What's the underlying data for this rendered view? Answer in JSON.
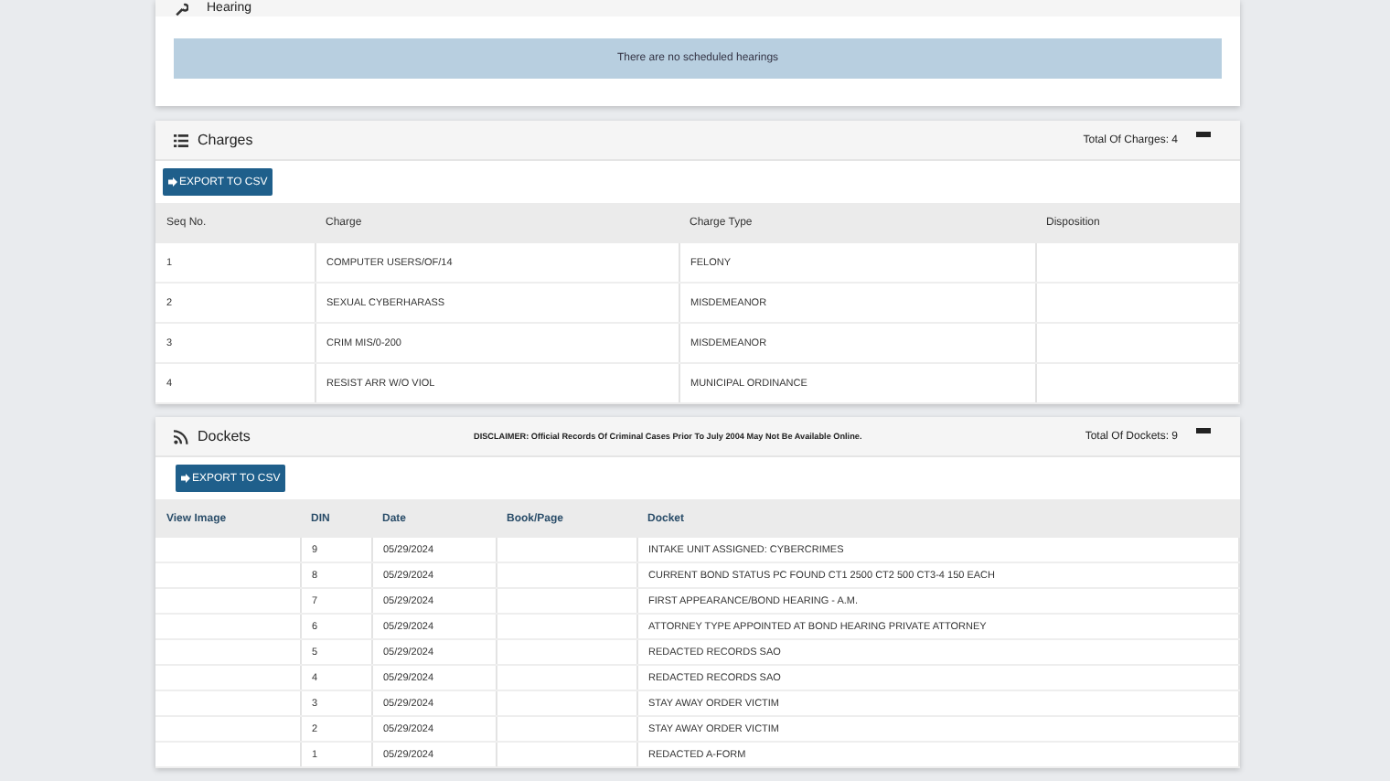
{
  "hearing": {
    "title": "Hearing",
    "message": "There are no scheduled hearings"
  },
  "charges": {
    "title": "Charges",
    "total": "Total Of Charges: 4",
    "export": "EXPORT TO CSV",
    "columns": [
      "Seq No.",
      "Charge",
      "Charge Type",
      "Disposition"
    ],
    "rows": [
      [
        "1",
        "COMPUTER USERS/OF/14",
        "FELONY",
        ""
      ],
      [
        "2",
        "SEXUAL CYBERHARASS",
        "MISDEMEANOR",
        ""
      ],
      [
        "3",
        "CRIM MIS/0-200",
        "MISDEMEANOR",
        ""
      ],
      [
        "4",
        "RESIST ARR W/O VIOL",
        "MUNICIPAL ORDINANCE",
        ""
      ]
    ]
  },
  "dockets": {
    "title": "Dockets",
    "disclaimer": "DISCLAIMER: Official Records Of Criminal Cases Prior To July 2004 May Not Be Available Online.",
    "total": "Total Of Dockets: 9",
    "export": "EXPORT TO CSV",
    "columns": [
      "View Image",
      "DIN",
      "Date",
      "Book/Page",
      "Docket"
    ],
    "rows": [
      [
        "",
        "9",
        "05/29/2024",
        "",
        "INTAKE UNIT ASSIGNED: CYBERCRIMES"
      ],
      [
        "",
        "8",
        "05/29/2024",
        "",
        "CURRENT BOND STATUS PC FOUND CT1 2500 CT2 500 CT3-4 150 EACH"
      ],
      [
        "",
        "7",
        "05/29/2024",
        "",
        "FIRST APPEARANCE/BOND HEARING - A.M."
      ],
      [
        "",
        "6",
        "05/29/2024",
        "",
        "ATTORNEY TYPE APPOINTED AT BOND HEARING PRIVATE ATTORNEY"
      ],
      [
        "",
        "5",
        "05/29/2024",
        "",
        "REDACTED RECORDS SAO"
      ],
      [
        "",
        "4",
        "05/29/2024",
        "",
        "REDACTED RECORDS SAO"
      ],
      [
        "",
        "3",
        "05/29/2024",
        "",
        "STAY AWAY ORDER VICTIM"
      ],
      [
        "",
        "2",
        "05/29/2024",
        "",
        "STAY AWAY ORDER VICTIM"
      ],
      [
        "",
        "1",
        "05/29/2024",
        "",
        "REDACTED A-FORM"
      ]
    ]
  }
}
